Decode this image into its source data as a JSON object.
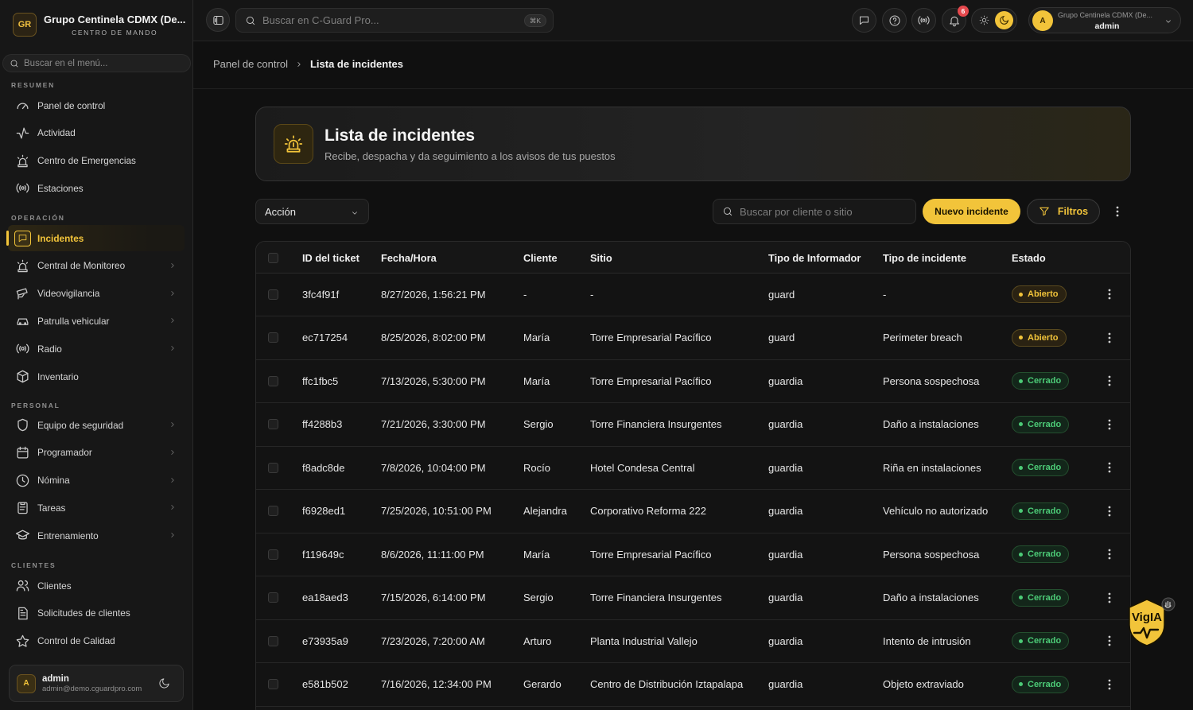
{
  "org": {
    "badge": "GR",
    "name": "Grupo Centinela CDMX (De...",
    "subtitle": "CENTRO DE MANDO"
  },
  "sidebar": {
    "search_placeholder": "Buscar en el menú...",
    "sections": [
      {
        "title": "RESUMEN",
        "items": [
          {
            "label": "Panel de control",
            "icon": "gauge-icon"
          },
          {
            "label": "Actividad",
            "icon": "activity-icon"
          },
          {
            "label": "Centro de Emergencias",
            "icon": "siren-icon"
          },
          {
            "label": "Estaciones",
            "icon": "radio-waves-icon"
          }
        ]
      },
      {
        "title": "OPERACIÓN",
        "items": [
          {
            "label": "Incidentes",
            "icon": "message-square-icon",
            "active": true
          },
          {
            "label": "Central de Monitoreo",
            "icon": "siren-icon",
            "chevron": true
          },
          {
            "label": "Videovigilancia",
            "icon": "cctv-icon",
            "chevron": true
          },
          {
            "label": "Patrulla vehicular",
            "icon": "car-icon",
            "chevron": true
          },
          {
            "label": "Radio",
            "icon": "radio-waves-icon",
            "chevron": true
          },
          {
            "label": "Inventario",
            "icon": "package-icon"
          }
        ]
      },
      {
        "title": "PERSONAL",
        "items": [
          {
            "label": "Equipo de seguridad",
            "icon": "shield-icon",
            "chevron": true
          },
          {
            "label": "Programador",
            "icon": "calendar-icon",
            "chevron": true
          },
          {
            "label": "Nómina",
            "icon": "clock-icon",
            "chevron": true
          },
          {
            "label": "Tareas",
            "icon": "clipboard-icon",
            "chevron": true
          },
          {
            "label": "Entrenamiento",
            "icon": "graduation-cap-icon",
            "chevron": true
          }
        ]
      },
      {
        "title": "CLIENTES",
        "items": [
          {
            "label": "Clientes",
            "icon": "users-icon"
          },
          {
            "label": "Solicitudes de clientes",
            "icon": "file-text-icon"
          },
          {
            "label": "Control de Calidad",
            "icon": "star-icon"
          }
        ]
      }
    ],
    "user": {
      "initial": "A",
      "name": "admin",
      "email": "admin@demo.cguardpro.com"
    }
  },
  "topbar": {
    "search_placeholder": "Buscar en C-Guard Pro...",
    "shortcut": "⌘K",
    "notifications_count": "6",
    "org_switch": {
      "initial": "A",
      "org": "Grupo Centinela CDMX (De...",
      "user": "admin"
    }
  },
  "breadcrumb": {
    "parent": "Panel de control",
    "current": "Lista de incidentes"
  },
  "hero": {
    "title": "Lista de incidentes",
    "subtitle": "Recibe, despacha y da seguimiento a los avisos de tus puestos"
  },
  "toolbar": {
    "action_label": "Acción",
    "search_placeholder": "Buscar por cliente o sitio",
    "new_button": "Nuevo incidente",
    "filters_button": "Filtros"
  },
  "table": {
    "columns": [
      "ID del ticket",
      "Fecha/Hora",
      "Cliente",
      "Sitio",
      "Tipo de Informador",
      "Tipo de incidente",
      "Estado"
    ],
    "rows": [
      {
        "id": "3fc4f91f",
        "datetime": "8/27/2026, 1:56:21 PM",
        "client": "-",
        "site": "-",
        "reporter": "guard",
        "type": "-",
        "status": "Abierto",
        "status_kind": "open"
      },
      {
        "id": "ec717254",
        "datetime": "8/25/2026, 8:02:00 PM",
        "client": "María",
        "site": "Torre Empresarial Pacífico",
        "reporter": "guard",
        "type": "Perimeter breach",
        "status": "Abierto",
        "status_kind": "open"
      },
      {
        "id": "ffc1fbc5",
        "datetime": "7/13/2026, 5:30:00 PM",
        "client": "María",
        "site": "Torre Empresarial Pacífico",
        "reporter": "guardia",
        "type": "Persona sospechosa",
        "status": "Cerrado",
        "status_kind": "closed"
      },
      {
        "id": "ff4288b3",
        "datetime": "7/21/2026, 3:30:00 PM",
        "client": "Sergio",
        "site": "Torre Financiera Insurgentes",
        "reporter": "guardia",
        "type": "Daño a instalaciones",
        "status": "Cerrado",
        "status_kind": "closed"
      },
      {
        "id": "f8adc8de",
        "datetime": "7/8/2026, 10:04:00 PM",
        "client": "Rocío",
        "site": "Hotel Condesa Central",
        "reporter": "guardia",
        "type": "Riña en instalaciones",
        "status": "Cerrado",
        "status_kind": "closed"
      },
      {
        "id": "f6928ed1",
        "datetime": "7/25/2026, 10:51:00 PM",
        "client": "Alejandra",
        "site": "Corporativo Reforma 222",
        "reporter": "guardia",
        "type": "Vehículo no autorizado",
        "status": "Cerrado",
        "status_kind": "closed"
      },
      {
        "id": "f119649c",
        "datetime": "8/6/2026, 11:11:00 PM",
        "client": "María",
        "site": "Torre Empresarial Pacífico",
        "reporter": "guardia",
        "type": "Persona sospechosa",
        "status": "Cerrado",
        "status_kind": "closed"
      },
      {
        "id": "ea18aed3",
        "datetime": "7/15/2026, 6:14:00 PM",
        "client": "Sergio",
        "site": "Torre Financiera Insurgentes",
        "reporter": "guardia",
        "type": "Daño a instalaciones",
        "status": "Cerrado",
        "status_kind": "closed"
      },
      {
        "id": "e73935a9",
        "datetime": "7/23/2026, 7:20:00 AM",
        "client": "Arturo",
        "site": "Planta Industrial Vallejo",
        "reporter": "guardia",
        "type": "Intento de intrusión",
        "status": "Cerrado",
        "status_kind": "closed"
      },
      {
        "id": "e581b502",
        "datetime": "7/16/2026, 12:34:00 PM",
        "client": "Gerardo",
        "site": "Centro de Distribución Iztapalapa",
        "reporter": "guardia",
        "type": "Objeto extraviado",
        "status": "Cerrado",
        "status_kind": "closed"
      }
    ]
  },
  "assistant": {
    "label": "VigIA"
  },
  "colors": {
    "accent": "#f2c43a",
    "open": "#f2c43a",
    "closed": "#4ccb77",
    "badge": "#e5484d"
  }
}
